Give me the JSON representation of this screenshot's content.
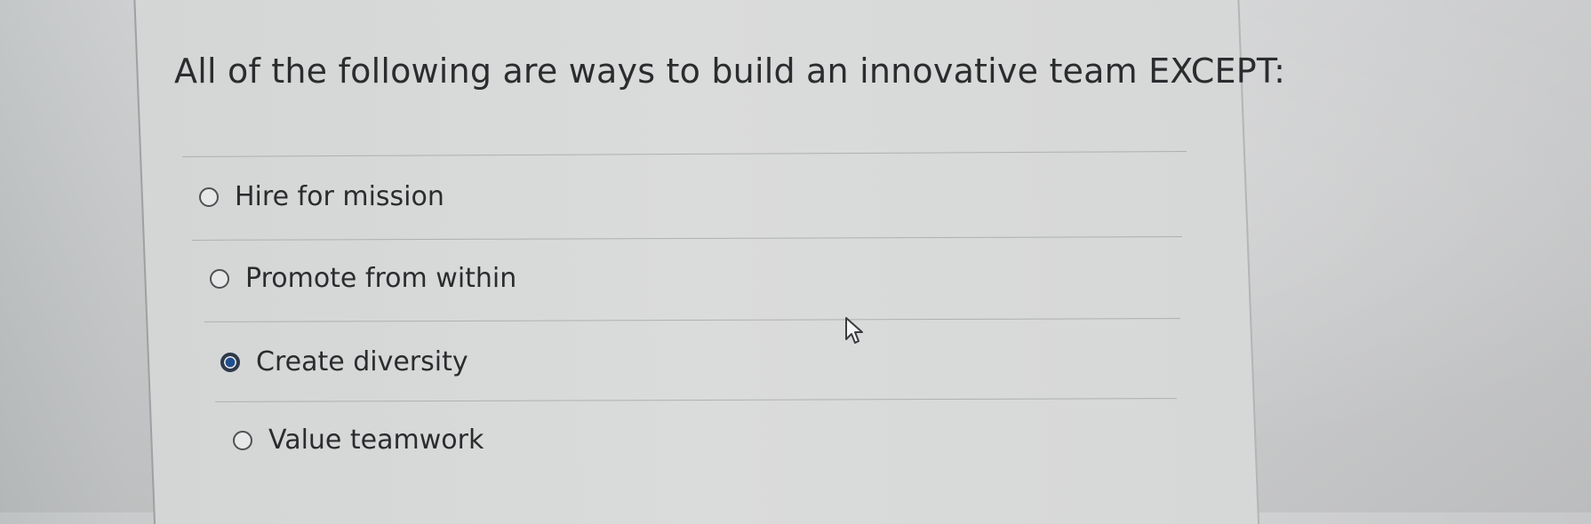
{
  "question": {
    "text": "All of the following are ways to build an innovative team EXCEPT:"
  },
  "options": [
    {
      "label": "Hire for mission",
      "selected": false
    },
    {
      "label": "Promote from within",
      "selected": false
    },
    {
      "label": "Create diversity",
      "selected": true
    },
    {
      "label": "Value teamwork",
      "selected": false
    }
  ],
  "colors": {
    "text": "#2a2c2e",
    "selected_radio": "#1f4f8f"
  },
  "cursor": {
    "icon": "mouse-pointer-icon"
  }
}
